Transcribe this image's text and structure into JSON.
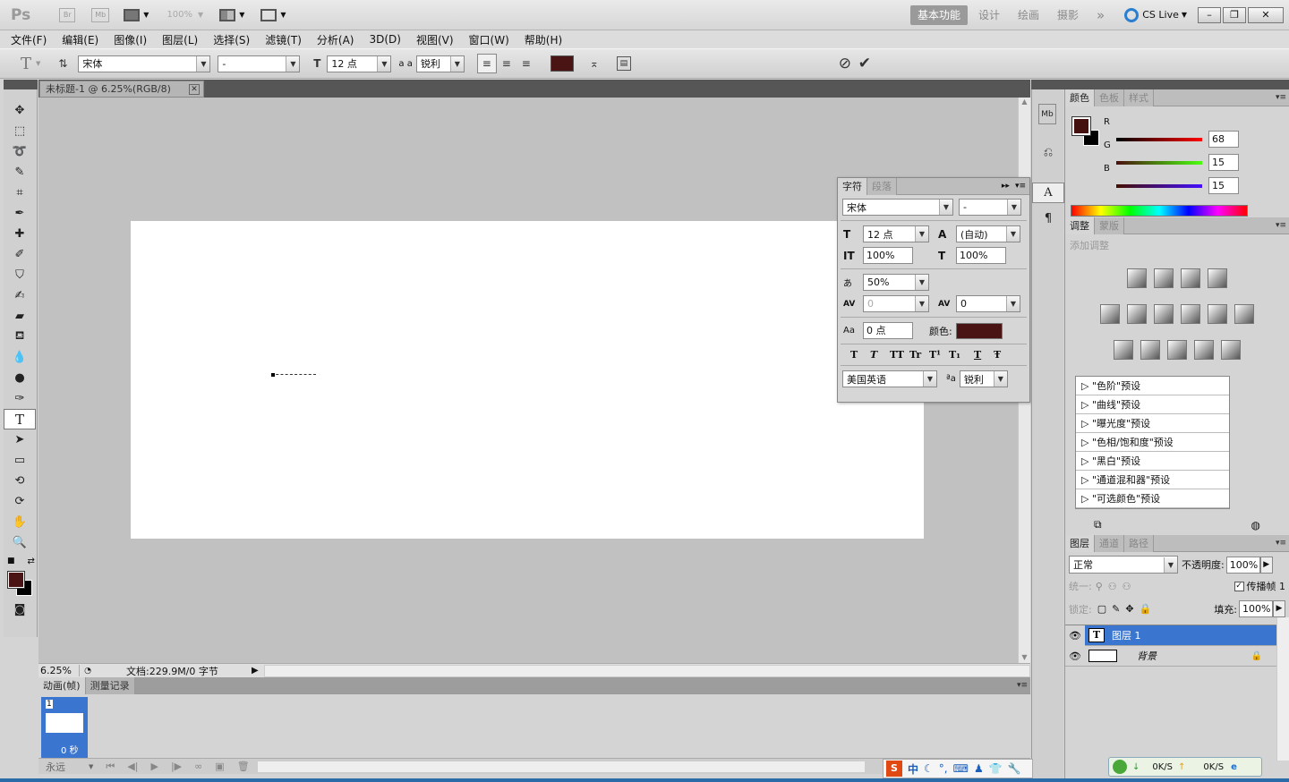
{
  "app": {
    "logo": "Ps",
    "br": "Br",
    "mb": "Mb",
    "zoom": "100%",
    "workspaces": [
      "基本功能",
      "设计",
      "绘画",
      "摄影"
    ],
    "active_ws": "基本功能",
    "more": "»",
    "cslive": "CS Live"
  },
  "menu": [
    "文件(F)",
    "编辑(E)",
    "图像(I)",
    "图层(L)",
    "选择(S)",
    "滤镜(T)",
    "分析(A)",
    "3D(D)",
    "视图(V)",
    "窗口(W)",
    "帮助(H)"
  ],
  "options": {
    "font_family": "宋体",
    "font_style": "-",
    "font_size": "12 点",
    "aa_label": "a a",
    "aa": "锐利",
    "color": "#4a1414"
  },
  "document": {
    "tab_title": "未标题-1 @ 6.25%(RGB/8)",
    "zoom": "6.25%",
    "status": "文档:229.9M/0 字节"
  },
  "character": {
    "tabs": [
      "字符",
      "段落"
    ],
    "font": "宋体",
    "style": "-",
    "size": "12 点",
    "leading": "(自动)",
    "vscale": "100%",
    "hscale": "100%",
    "tsume": "50%",
    "kerning": "0",
    "tracking": "0",
    "baseline": "0 点",
    "color_label": "颜色:",
    "color": "#4a1414",
    "lang": "美国英语",
    "aa": "锐利",
    "styles": [
      "T",
      "T",
      "TT",
      "Tr",
      "T¹",
      "T₁",
      "T",
      "Ŧ"
    ]
  },
  "color_panel": {
    "tabs": [
      "颜色",
      "色板",
      "样式"
    ],
    "r": "68",
    "g": "15",
    "b": "15",
    "r_label": "R",
    "g_label": "G",
    "b_label": "B",
    "fg": "#440f0f",
    "bg": "#000000"
  },
  "adjust": {
    "tabs": [
      "调整",
      "蒙版"
    ],
    "add_label": "添加调整",
    "presets": [
      "\"色阶\"预设",
      "\"曲线\"预设",
      "\"曝光度\"预设",
      "\"色相/饱和度\"预设",
      "\"黑白\"预设",
      "\"通道混和器\"预设",
      "\"可选颜色\"预设"
    ]
  },
  "layers": {
    "tabs": [
      "图层",
      "通道",
      "路径"
    ],
    "blend": "正常",
    "opacity_label": "不透明度:",
    "opacity": "100%",
    "unify_label": "统一:",
    "propagate_label": "传播帧 1",
    "lock_label": "锁定:",
    "fill_label": "填充:",
    "fill": "100%",
    "items": [
      {
        "name": "图层 1",
        "type": "text",
        "selected": true
      },
      {
        "name": "背景",
        "type": "bg",
        "selected": false
      }
    ]
  },
  "animation": {
    "tabs": [
      "动画(帧)",
      "测量记录"
    ],
    "frame_num": "1",
    "frame_time": "0 秒",
    "loop": "永远"
  },
  "tray": {
    "ime": "中",
    "down": "0K/S",
    "up": "0K/S"
  }
}
